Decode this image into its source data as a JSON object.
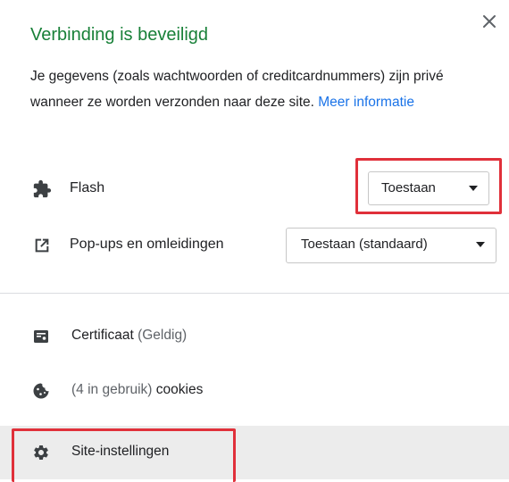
{
  "header": {
    "title": "Verbinding is beveiligd",
    "close_icon": "close-icon"
  },
  "description": {
    "text": "Je gegevens (zoals wachtwoorden of creditcardnummers) zijn privé wanneer ze worden verzonden naar deze site.",
    "link": "Meer informatie"
  },
  "permissions": [
    {
      "icon": "puzzle-icon",
      "label": "Flash",
      "value": "Toestaan",
      "highlighted": true
    },
    {
      "icon": "popup-open-icon",
      "label": "Pop-ups en omleidingen",
      "value": "Toestaan (standaard)",
      "highlighted": false
    }
  ],
  "items": [
    {
      "icon": "certificate-icon",
      "label": "Certificaat",
      "suffix": "(Geldig)"
    },
    {
      "icon": "cookie-icon",
      "prefix": "(4 in gebruik)",
      "label": "cookies"
    },
    {
      "icon": "gear-icon",
      "label": "Site-instellingen",
      "highlighted": true
    }
  ],
  "colors": {
    "title": "#188038",
    "link": "#1a73e8",
    "highlight": "#e0303a"
  }
}
